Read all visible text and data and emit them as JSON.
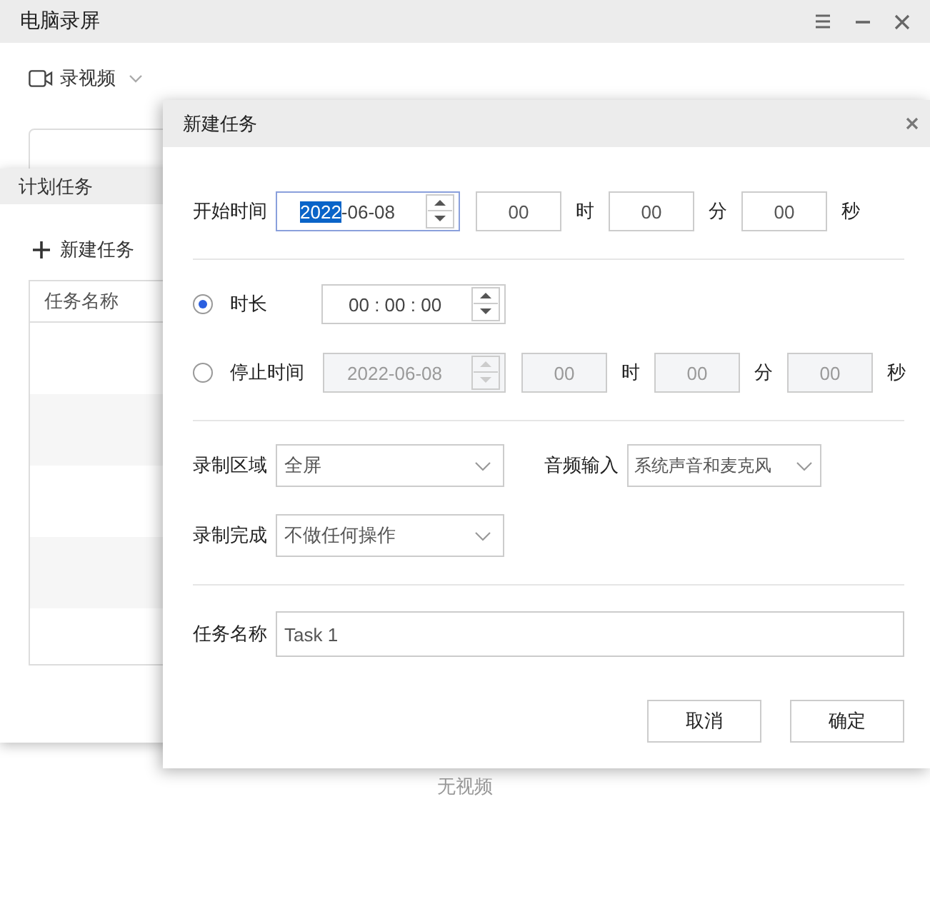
{
  "main_window": {
    "title": "电脑录屏",
    "record_mode": "录视频",
    "empty_text": "无视频"
  },
  "schedule_panel": {
    "title": "计划任务",
    "new_task_button": "新建任务",
    "table": {
      "columns": [
        "任务名称"
      ]
    }
  },
  "dialog": {
    "title": "新建任务",
    "start_time": {
      "label": "开始时间",
      "date": [
        {
          "text": "2022",
          "selected": true
        },
        {
          "text": "-06-08",
          "selected": false
        }
      ],
      "hour": "00",
      "hour_unit": "时",
      "minute": "00",
      "minute_unit": "分",
      "second": "00",
      "second_unit": "秒"
    },
    "end_modes": [
      {
        "kind": "duration",
        "label": "时长",
        "selected": true,
        "disabled": false,
        "value": "00 : 00 : 00"
      },
      {
        "kind": "stop_time",
        "label": "停止时间",
        "selected": false,
        "disabled": true,
        "date": "2022-06-08",
        "hour": "00",
        "hour_unit": "时",
        "minute": "00",
        "minute_unit": "分",
        "second": "00",
        "second_unit": "秒"
      }
    ],
    "record_area": {
      "label": "录制区域",
      "value": "全屏"
    },
    "audio_input": {
      "label": "音频输入",
      "value": "系统声音和麦克风"
    },
    "on_finish": {
      "label": "录制完成",
      "value": "不做任何操作"
    },
    "task_name": {
      "label": "任务名称",
      "value": "Task 1"
    },
    "buttons": [
      "取消",
      "确定"
    ]
  }
}
